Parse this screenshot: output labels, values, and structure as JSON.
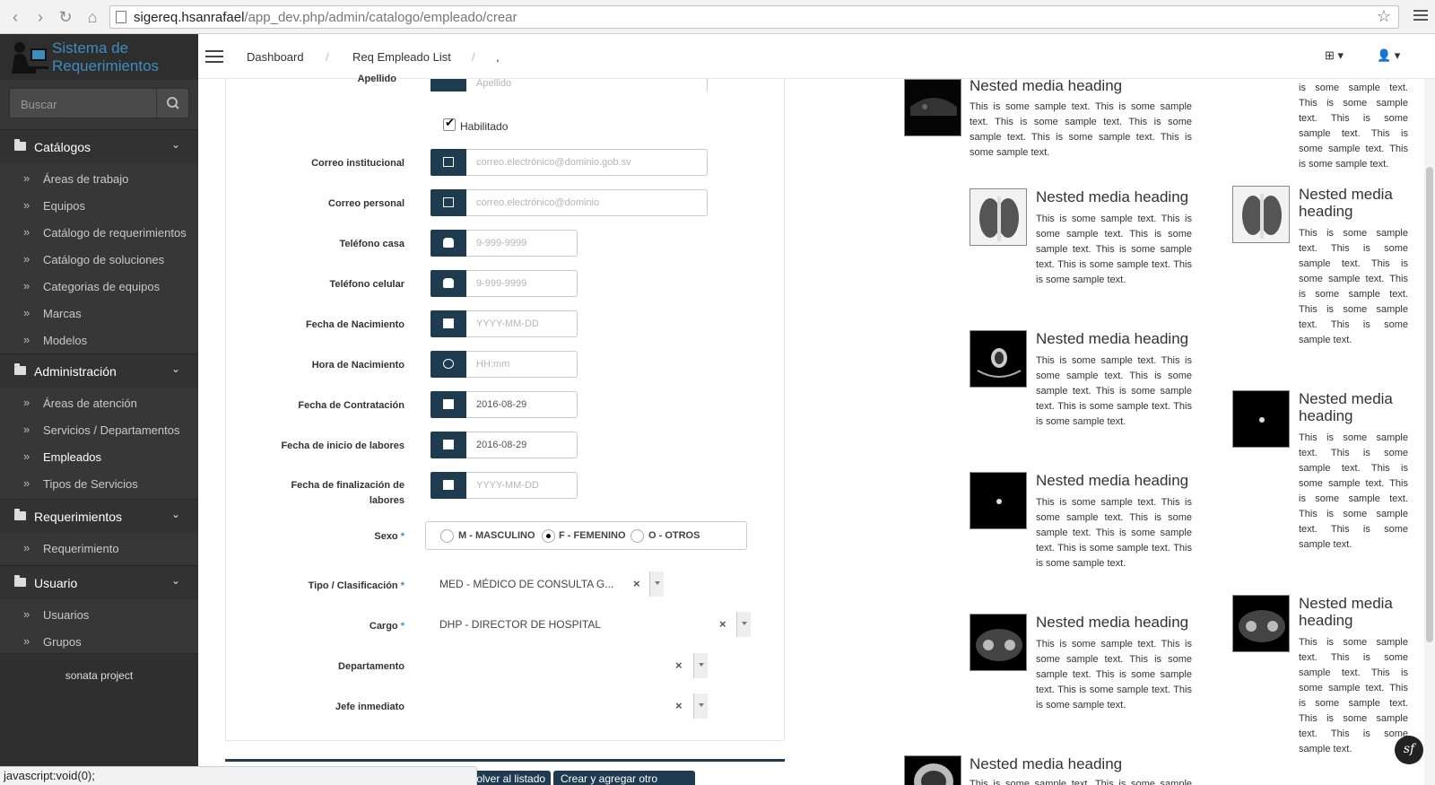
{
  "browser": {
    "url_host": "sigereq.hsanrafael",
    "url_path": "/app_dev.php/admin/catalogo/empleado/crear",
    "status_text": "javascript:void(0);"
  },
  "sidebar": {
    "logo_line1": "Sistema de",
    "logo_line2": "Requerimientos",
    "search_placeholder": "Buscar",
    "sections": [
      {
        "label": "Catálogos",
        "items": [
          "Áreas de trabajo",
          "Equipos",
          "Catálogo de requerimientos",
          "Catálogo de soluciones",
          "Categorias de equipos",
          "Marcas",
          "Modelos"
        ]
      },
      {
        "label": "Administración",
        "items": [
          "Áreas de atención",
          "Servicios / Departamentos",
          "Empleados",
          "Tipos de Servicios"
        ]
      },
      {
        "label": "Requerimientos",
        "items": [
          "Requerimiento"
        ]
      },
      {
        "label": "Usuario",
        "items": [
          "Usuarios",
          "Grupos"
        ]
      }
    ],
    "active_item": "Empleados",
    "footer": "sonata project"
  },
  "topbar": {
    "breadcrumbs": [
      "Dashboard",
      "Req Empleado List",
      ","
    ]
  },
  "form": {
    "apellido_label": "Apellido",
    "apellido_placeholder": "Apellido",
    "habilitado_label": "Habilitado",
    "correo_institucional_label": "Correo institucional",
    "correo_institucional_placeholder": "correo.electrónico@dominio.gob.sv",
    "correo_personal_label": "Correo personal",
    "correo_personal_placeholder": "correo.electrónico@dominio",
    "telefono_casa_label": "Teléfono casa",
    "telefono_casa_placeholder": "9-999-9999",
    "telefono_celular_label": "Teléfono celular",
    "telefono_celular_placeholder": "9-999-9999",
    "fecha_nacimiento_label": "Fecha de Nacimiento",
    "fecha_nacimiento_placeholder": "YYYY-MM-DD",
    "hora_nacimiento_label": "Hora de Nacimiento",
    "hora_nacimiento_placeholder": "HH:mm",
    "fecha_contratacion_label": "Fecha de Contratación",
    "fecha_contratacion_value": "2016-08-29",
    "fecha_inicio_label": "Fecha de inicio de labores",
    "fecha_inicio_value": "2016-08-29",
    "fecha_fin_label_1": "Fecha de finalización de",
    "fecha_fin_label_2": "labores",
    "fecha_fin_placeholder": "YYYY-MM-DD",
    "sexo_label": "Sexo",
    "sexo_options": [
      "M - MASCULINO",
      "F - FEMENINO",
      "O - OTROS"
    ],
    "tipo_label": "Tipo / Clasificación",
    "tipo_value": "MED - MÉDICO DE CONSULTA G...",
    "cargo_label": "Cargo",
    "cargo_value": "DHP - DIRECTOR DE HOSPITAL",
    "departamento_label": "Departamento",
    "jefe_label": "Jefe inmediato",
    "required_mark": "*",
    "btn_listado": "y volver al listado",
    "btn_crear": "Crear y agregar otro"
  },
  "media": {
    "heading": "Nested media heading",
    "text": "This is some sample text. This is some sample text. This is some sample text. This is some sample text. This is some sample text. This is some sample text.",
    "text_top_right": "is some sample text. This is some sample text. This is some sample text. This is some sample text. This is some sample text."
  }
}
